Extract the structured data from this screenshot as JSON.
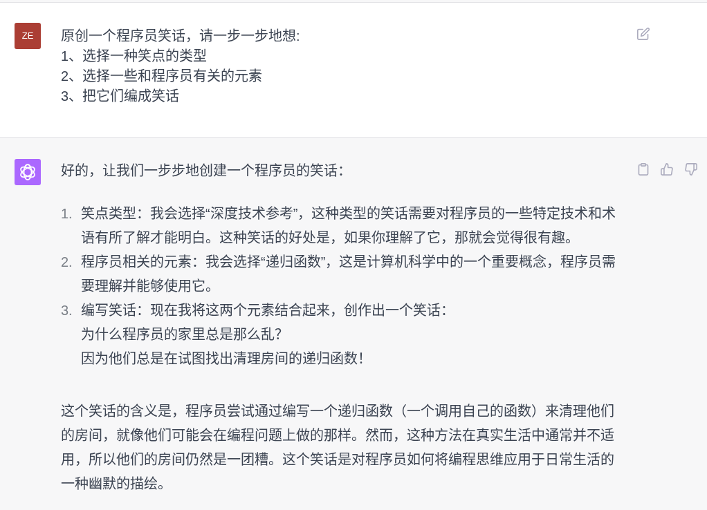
{
  "messages": [
    {
      "kind": "user",
      "avatar": "ZE",
      "lines": [
        "原创一个程序员笑话，请一步一步地想:",
        "1、选择一种笑点的类型",
        "2、选择一些和程序员有关的元素",
        "3、把它们编成笑话"
      ]
    },
    {
      "kind": "assistant",
      "intro": "好的，让我们一步步地创建一个程序员的笑话：",
      "steps": [
        {
          "number": "1.",
          "text": "笑点类型：我会选择“深度技术参考”，这种类型的笑话需要对程序员的一些特定技术和术语有所了解才能明白。这种笑话的好处是，如果你理解了它，那就会觉得很有趣。"
        },
        {
          "number": "2.",
          "text": "程序员相关的元素：我会选择“递归函数”，这是计算机科学中的一个重要概念，程序员需要理解并能够使用它。"
        },
        {
          "number": "3.",
          "text": "编写笑话：现在我将这两个元素结合起来，创作出一个笑话：",
          "joke_lines": [
            "为什么程序员的家里总是那么乱？",
            "因为他们总是在试图找出清理房间的递归函数！"
          ]
        }
      ],
      "conclusion": "这个笑话的含义是，程序员尝试通过编写一个递归函数（一个调用自己的函数）来清理他们的房间，就像他们可能会在编程问题上做的那样。然而，这种方法在真实生活中通常并不适用，所以他们的房间仍然是一团糟。这个笑话是对程序员如何将编程思维应用于日常生活的一种幽默的描绘。"
    }
  ]
}
